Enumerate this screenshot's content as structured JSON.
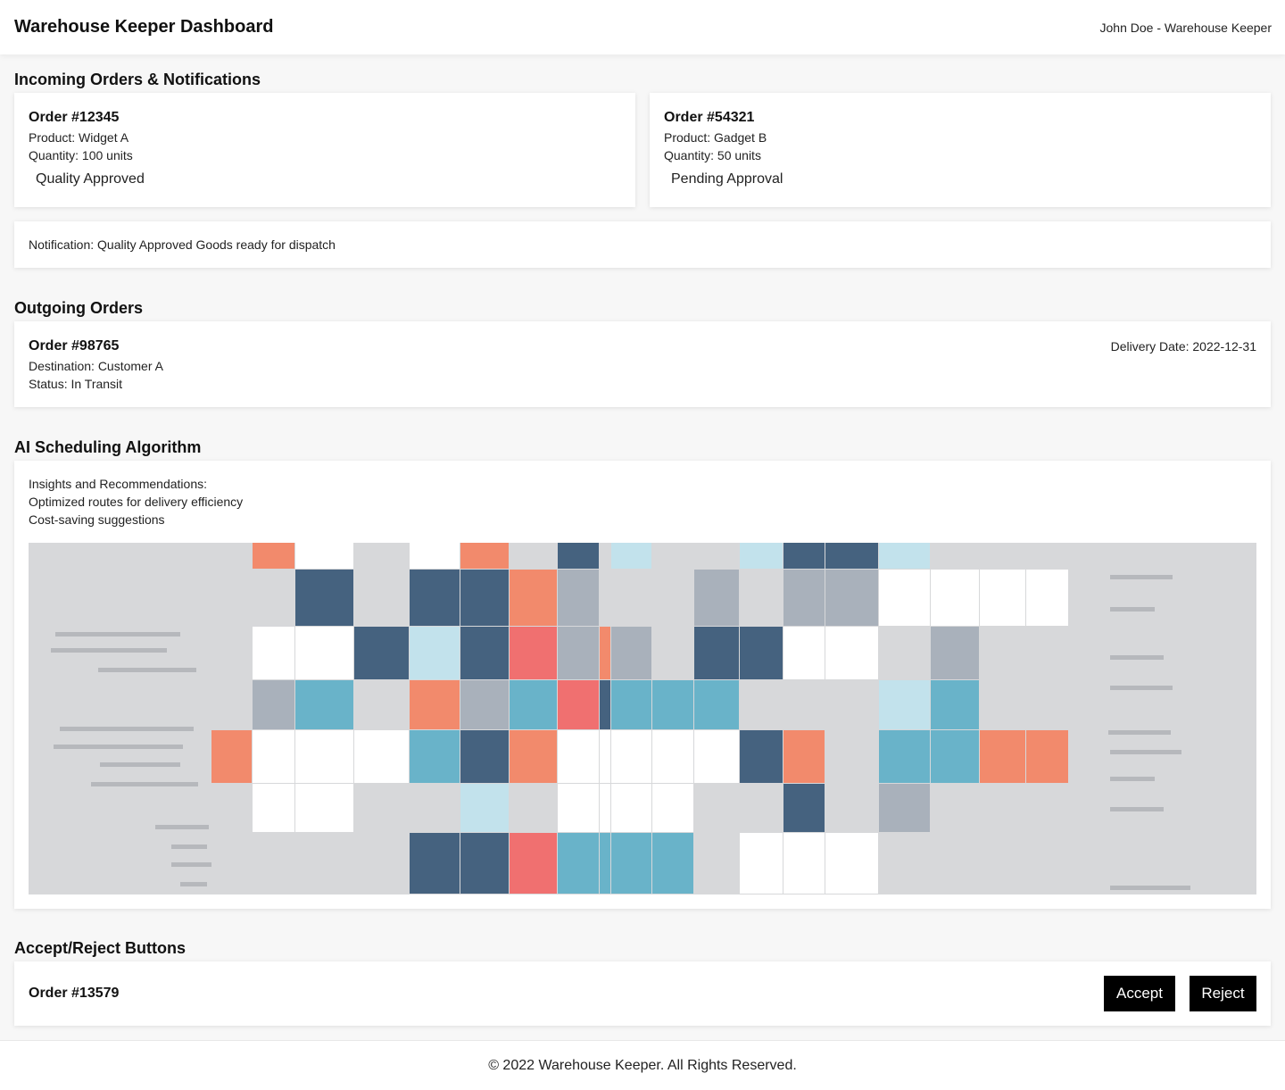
{
  "header": {
    "title": "Warehouse Keeper Dashboard",
    "user": "John Doe - Warehouse Keeper"
  },
  "incoming": {
    "section_title": "Incoming Orders & Notifications",
    "orders": [
      {
        "title": "Order #12345",
        "product": "Product: Widget A",
        "quantity": "Quantity: 100 units",
        "status": "Quality Approved"
      },
      {
        "title": "Order #54321",
        "product": "Product: Gadget B",
        "quantity": "Quantity: 50 units",
        "status": "Pending Approval"
      }
    ],
    "notification": "Notification: Quality Approved Goods ready for dispatch"
  },
  "outgoing": {
    "section_title": "Outgoing Orders",
    "order": {
      "title": "Order #98765",
      "destination": "Destination: Customer A",
      "status": "Status: In Transit",
      "delivery_date": "Delivery Date: 2022-12-31"
    }
  },
  "ai": {
    "section_title": "AI Scheduling Algorithm",
    "lines": [
      "Insights and Recommendations:",
      "Optimized routes for delivery efficiency",
      "Cost-saving suggestions"
    ],
    "image_colors": [
      "#d7d8da",
      "#ffffff",
      "#45627f",
      "#f28a6c",
      "#69b3c9",
      "#c2e2ec",
      "#a9b1bb",
      "#f07070"
    ]
  },
  "actions": {
    "section_title": "Accept/Reject Buttons",
    "order_title": "Order #13579",
    "accept_label": "Accept",
    "reject_label": "Reject"
  },
  "footer": {
    "text": "© 2022 Warehouse Keeper. All Rights Reserved."
  }
}
